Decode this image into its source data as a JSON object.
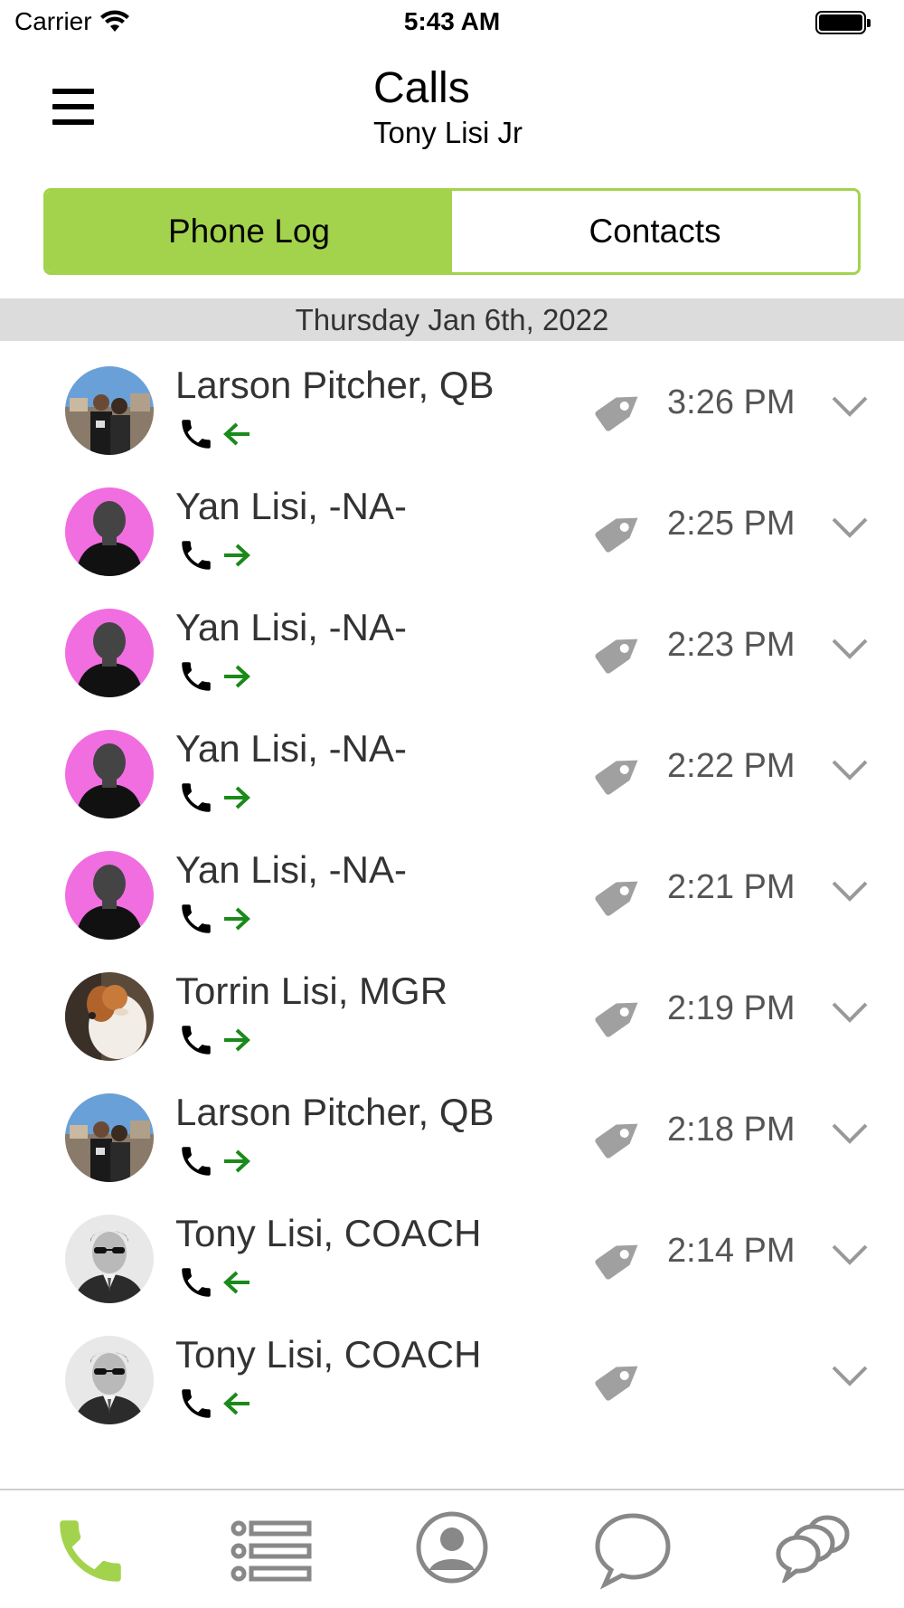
{
  "status_bar": {
    "carrier": "Carrier",
    "time": "5:43 AM",
    "icons": [
      "wifi-icon",
      "battery-icon"
    ]
  },
  "header": {
    "title": "Calls",
    "subtitle": "Tony Lisi Jr",
    "menu_icon": "hamburger-menu-icon"
  },
  "segmented": {
    "tabs": [
      {
        "label": "Phone Log",
        "active": true
      },
      {
        "label": "Contacts",
        "active": false
      }
    ]
  },
  "date_header": "Thursday Jan 6th, 2022",
  "calls": [
    {
      "name": "Larson Pitcher, QB",
      "direction": "incoming",
      "time": "3:26 PM",
      "avatar": "photo-couple"
    },
    {
      "name": "Yan Lisi, -NA-",
      "direction": "outgoing",
      "time": "2:25 PM",
      "avatar": "placeholder-pink"
    },
    {
      "name": "Yan Lisi, -NA-",
      "direction": "outgoing",
      "time": "2:23 PM",
      "avatar": "placeholder-pink"
    },
    {
      "name": "Yan Lisi, -NA-",
      "direction": "outgoing",
      "time": "2:22 PM",
      "avatar": "placeholder-pink"
    },
    {
      "name": "Yan Lisi, -NA-",
      "direction": "outgoing",
      "time": "2:21 PM",
      "avatar": "placeholder-pink"
    },
    {
      "name": "Torrin Lisi, MGR",
      "direction": "outgoing",
      "time": "2:19 PM",
      "avatar": "photo-dog"
    },
    {
      "name": "Larson Pitcher, QB",
      "direction": "outgoing",
      "time": "2:18 PM",
      "avatar": "photo-couple"
    },
    {
      "name": "Tony Lisi, COACH",
      "direction": "incoming",
      "time": "2:14 PM",
      "avatar": "photo-man"
    },
    {
      "name": "Tony Lisi, COACH",
      "direction": "incoming",
      "time": "",
      "avatar": "photo-man"
    }
  ],
  "tab_bar": {
    "tabs": [
      {
        "icon": "phone-icon",
        "active": true
      },
      {
        "icon": "list-icon",
        "active": false
      },
      {
        "icon": "profile-icon",
        "active": false
      },
      {
        "icon": "chat-bubble-icon",
        "active": false
      },
      {
        "icon": "group-chat-icon",
        "active": false
      }
    ]
  },
  "colors": {
    "accent": "#a3d34c",
    "direction_arrow": "#1a8a1a",
    "tag": "#a0a0a0",
    "date_header_bg": "#dcdcdc",
    "placeholder_avatar_bg": "#f06ee0"
  }
}
